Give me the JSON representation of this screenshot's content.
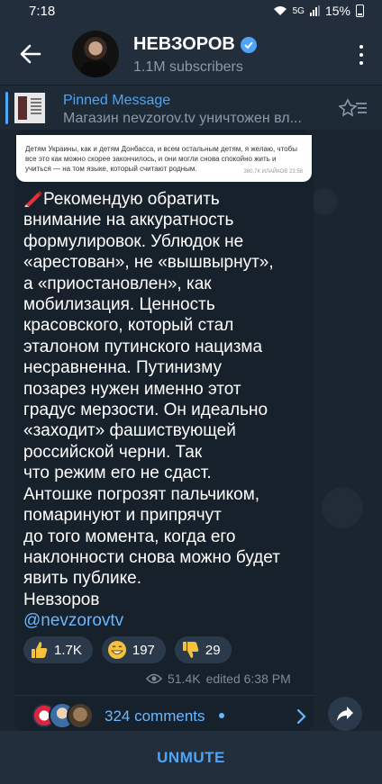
{
  "status": {
    "time": "7:18",
    "network": "5G",
    "battery": "15%"
  },
  "channel": {
    "name": "НЕВЗОРОВ",
    "subscribers": "1.1M subscribers"
  },
  "pinned": {
    "title": "Pinned Message",
    "text": "Магазин nevzorov.tv уничтожен вл..."
  },
  "photo_preview": {
    "text": "Детям Украины, как и детям Донбасса, и всем остальным детям, я желаю, чтобы все это как можно скорее закончилось, и они могли снова спокойно жить и учиться — на том языке, который считают родным.",
    "meta": "380,7К ИЛАЙКОВ 23:58"
  },
  "message": {
    "lines": [
      "Рекомендую обратить",
      "внимание на аккуратность",
      "формулировок.  Ублюдок не",
      "«арестован», не «вышвырнут»,",
      "а «приостановлен», как",
      "мобилизация.  Ценность",
      "красовского, который стал",
      "эталоном путинского нацизма",
      "несравненна.  Путинизму",
      "позарез нужен  именно этот",
      "градус мерзости.  Он идеально",
      "«заходит» фашиствующей",
      "российской черни.  Так",
      "что режим его не сдаст.",
      "Антошке погрозят пальчиком,",
      "помаринуют и припрячут",
      "до того момента, когда его",
      "наклонности снова можно будет",
      "явить публике.",
      "Невзоров"
    ],
    "handle": "@nevzorovtv"
  },
  "reactions": [
    {
      "emoji": "thumbs-up",
      "count": "1.7K"
    },
    {
      "emoji": "grinning-face",
      "count": "197"
    },
    {
      "emoji": "thumbs-down",
      "count": "29"
    }
  ],
  "views": "51.4K",
  "edited": "edited 6:38 PM",
  "comments": {
    "label": "324 comments"
  },
  "bottom": {
    "unmute": "UNMUTE"
  },
  "colors": {
    "accent": "#4ea4f6",
    "link": "#6ab7ff",
    "header_bg": "#232e3c",
    "bubble_bg": "#17212b"
  }
}
